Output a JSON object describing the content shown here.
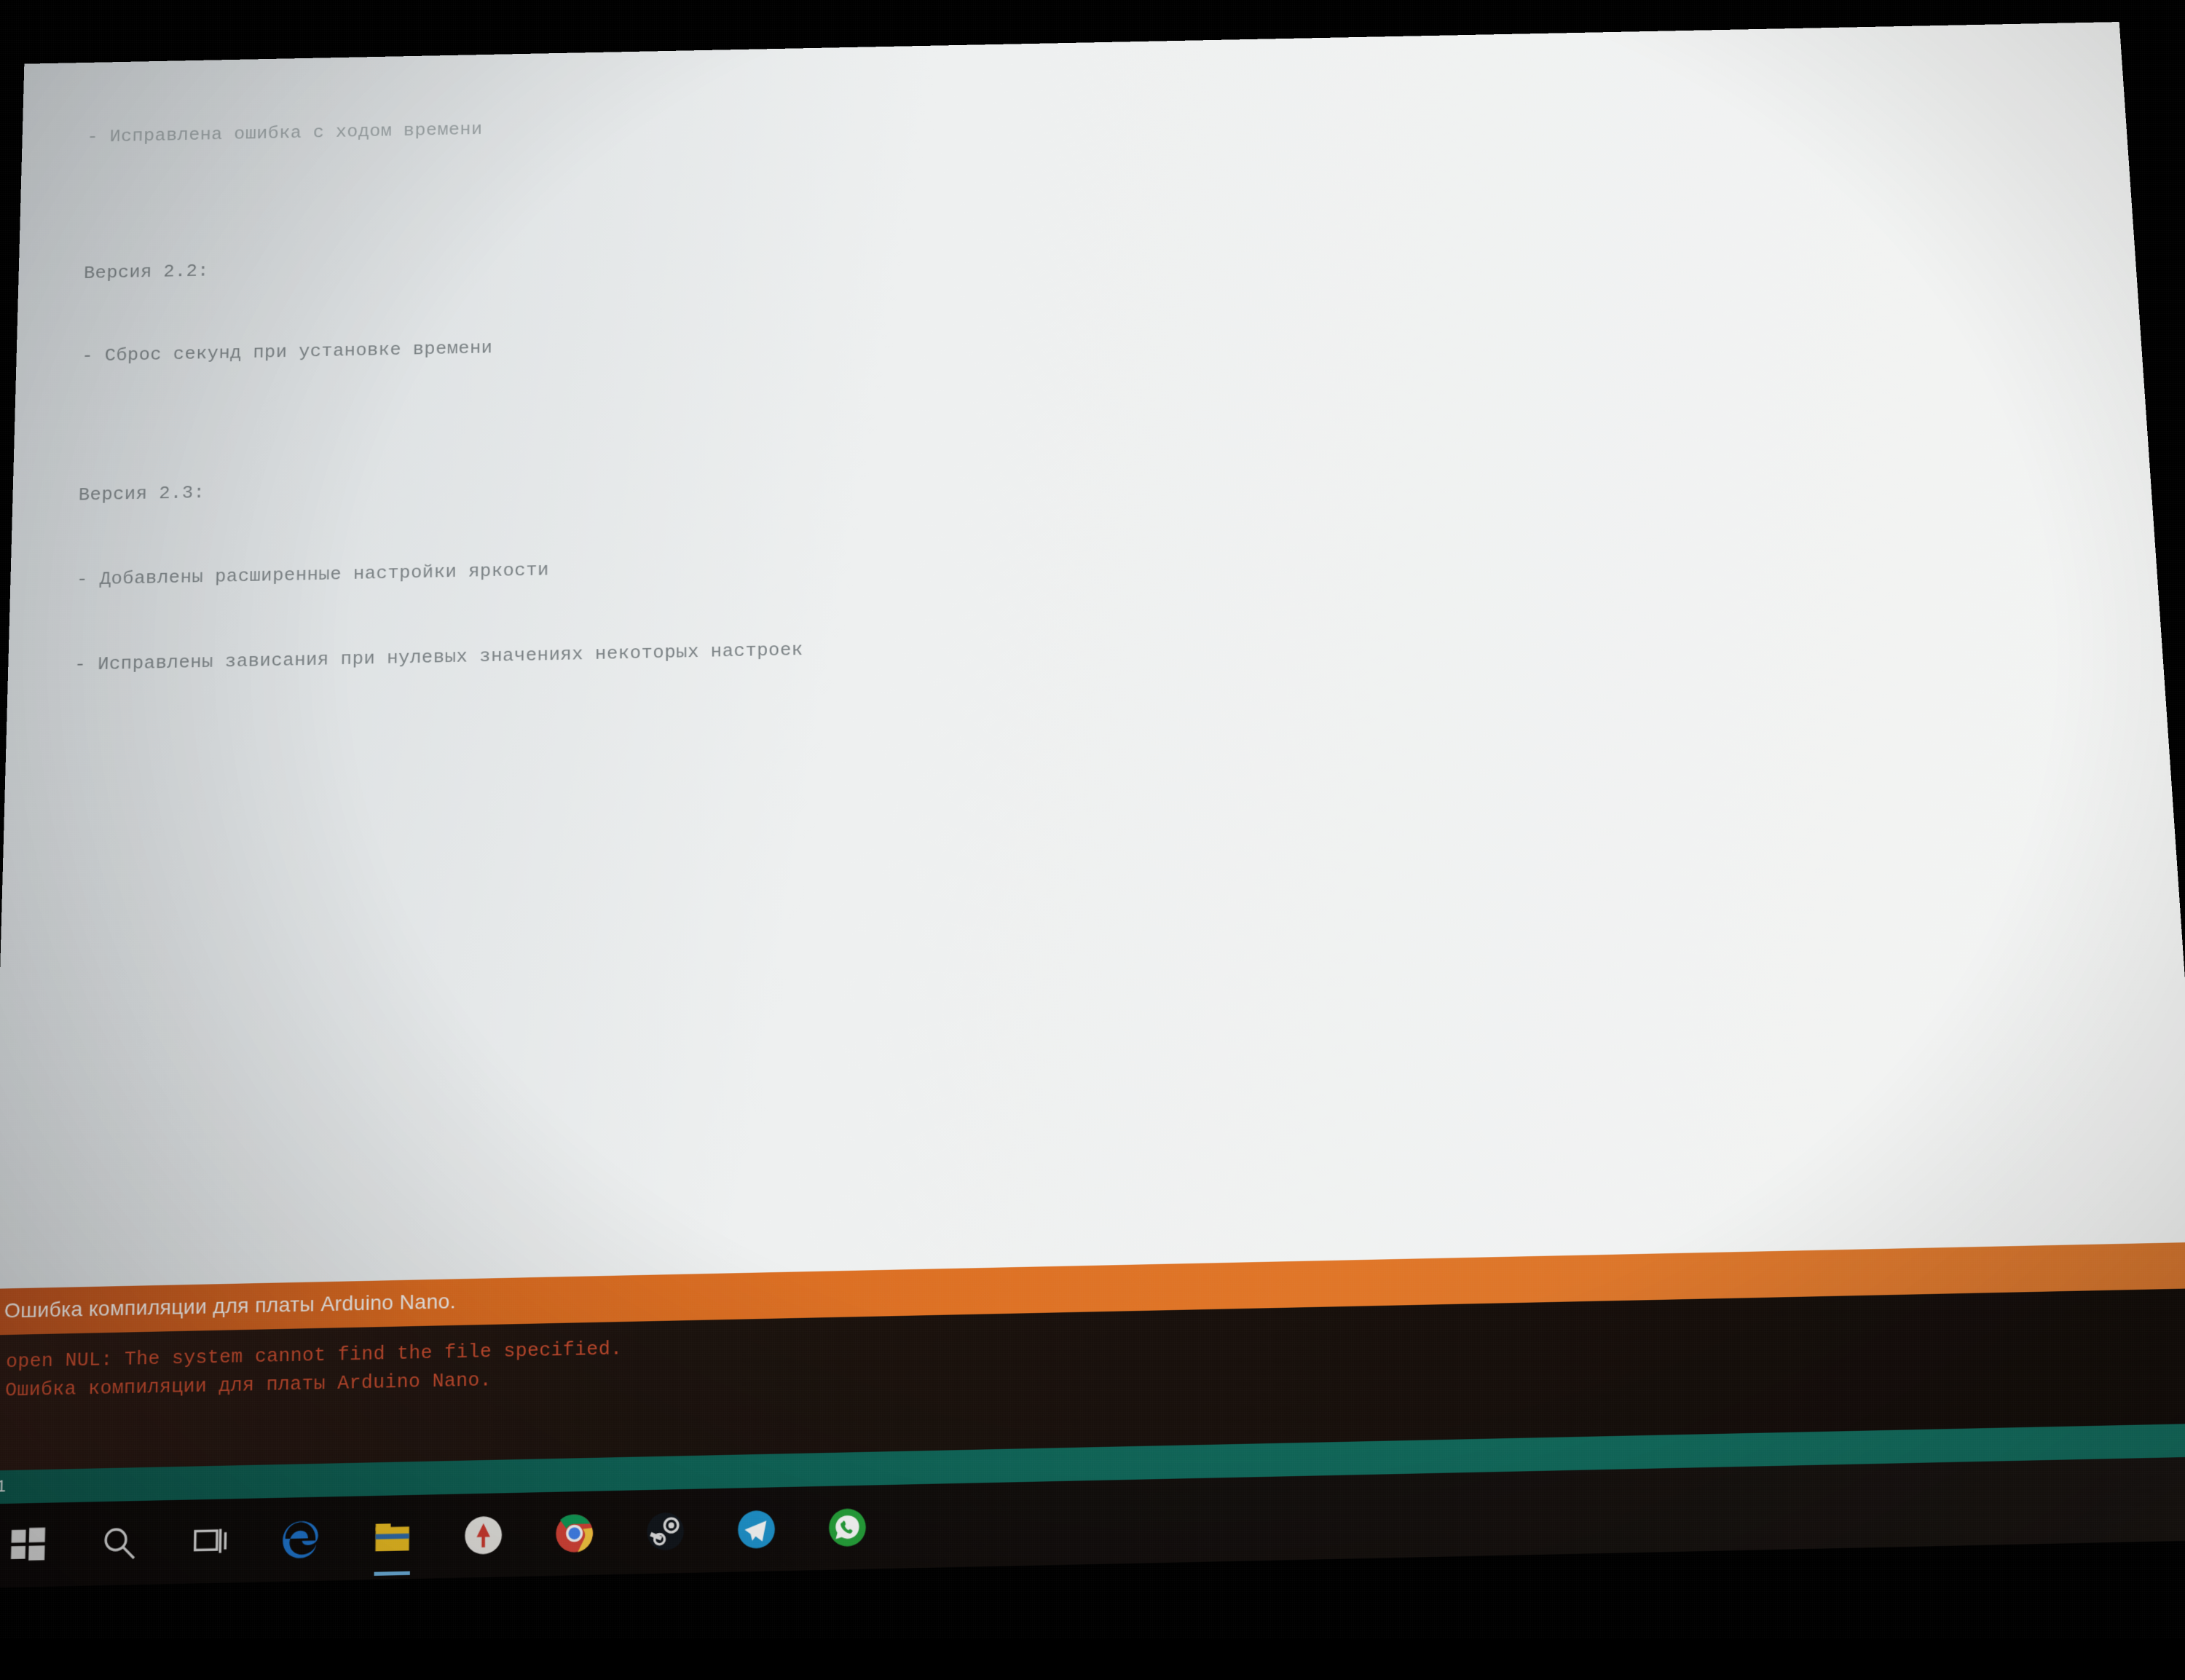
{
  "editor": {
    "lines": [
      "  - Исправлена ошибка с ходом времени",
      "",
      "  Версия 2.2:",
      "  - Сброс секунд при установке времени",
      "",
      "  Версия 2.3:",
      "  - Добавлены расширенные настройки яркости",
      "  - Исправлены зависания при нулевых значениях некоторых настроек"
    ]
  },
  "error_bar": {
    "text": "Ошибка компиляции для платы Arduino Nano."
  },
  "console": {
    "lines": [
      "open NUL: The system cannot find the file specified.",
      "Ошибка компиляции для платы Arduino Nano."
    ]
  },
  "status": {
    "text": "1"
  },
  "taskbar": {
    "items": [
      {
        "name": "start-icon",
        "label": "Start"
      },
      {
        "name": "search-icon",
        "label": "Search"
      },
      {
        "name": "task-view-icon",
        "label": "Task View"
      },
      {
        "name": "edge-icon",
        "label": "Microsoft Edge"
      },
      {
        "name": "file-explorer-icon",
        "label": "File Explorer",
        "active": true
      },
      {
        "name": "yandex-icon",
        "label": "Yandex Browser"
      },
      {
        "name": "chrome-icon",
        "label": "Google Chrome"
      },
      {
        "name": "steam-icon",
        "label": "Steam"
      },
      {
        "name": "telegram-icon",
        "label": "Telegram"
      },
      {
        "name": "whatsapp-icon",
        "label": "WhatsApp"
      }
    ]
  }
}
